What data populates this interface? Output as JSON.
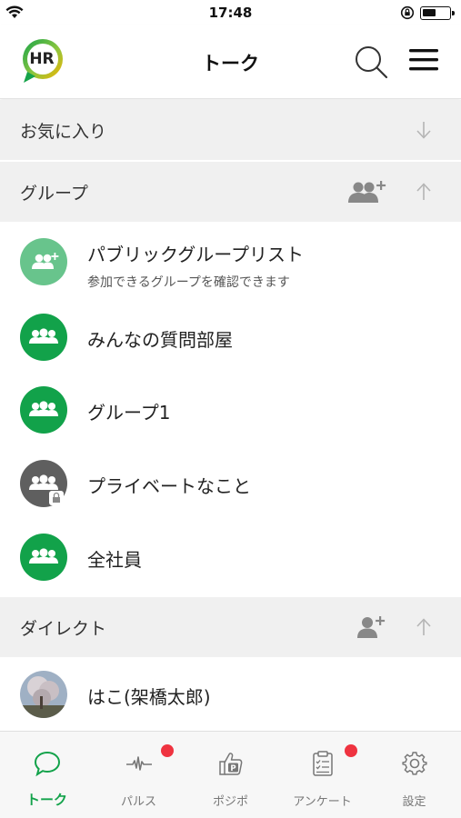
{
  "status_bar": {
    "time": "17:48"
  },
  "header": {
    "logo_text": "HR",
    "title": "トーク"
  },
  "sections": {
    "favorites": {
      "label": "お気に入り"
    },
    "groups": {
      "label": "グループ"
    },
    "direct": {
      "label": "ダイレクト"
    }
  },
  "groups": {
    "public_list": {
      "title": "パブリックグループリスト",
      "subtitle": "参加できるグループを確認できます"
    },
    "items": [
      {
        "title": "みんなの質問部屋"
      },
      {
        "title": "グループ1"
      },
      {
        "title": "プライベートなこと"
      },
      {
        "title": "全社員"
      }
    ]
  },
  "direct": {
    "items": [
      {
        "title": "はこ(架橋太郎)"
      }
    ]
  },
  "tabs": [
    {
      "label": "トーク",
      "icon": "chat-bubble-icon",
      "active": true,
      "badge": false
    },
    {
      "label": "パルス",
      "icon": "pulse-icon",
      "active": false,
      "badge": true
    },
    {
      "label": "ポジポ",
      "icon": "thumbs-up-p-icon",
      "active": false,
      "badge": false
    },
    {
      "label": "アンケート",
      "icon": "clipboard-icon",
      "active": false,
      "badge": true
    },
    {
      "label": "設定",
      "icon": "gear-icon",
      "active": false,
      "badge": false
    }
  ],
  "colors": {
    "brand_green": "#12a24a",
    "light_green": "#68c48c",
    "private_gray": "#5f5f5f",
    "badge_red": "#ef3340",
    "section_bg": "#f0f0f0"
  }
}
